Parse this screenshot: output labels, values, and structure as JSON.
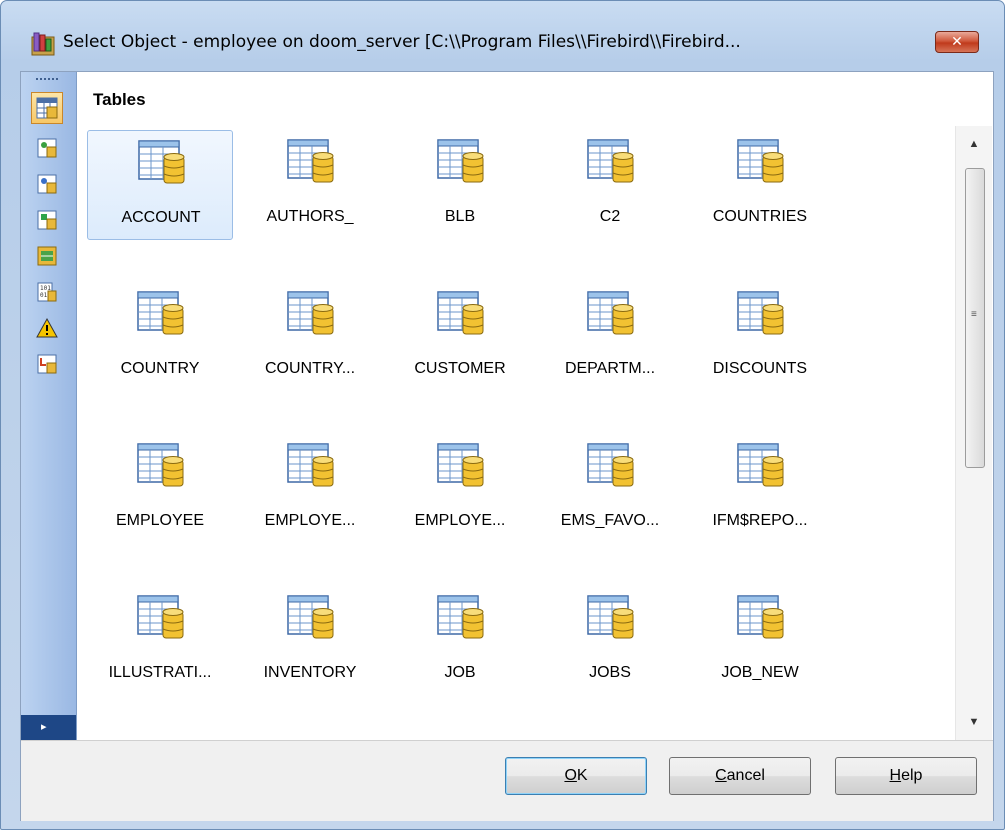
{
  "window": {
    "title": "Select Object - employee on doom_server [C:\\\\Program Files\\\\Firebird\\\\Firebird...",
    "close_glyph": "✕"
  },
  "section": {
    "title": "Tables"
  },
  "sidebar": {
    "items": [
      {
        "icon": "tables-icon",
        "active": true
      },
      {
        "icon": "views-icon",
        "active": false
      },
      {
        "icon": "procedures-icon",
        "active": false
      },
      {
        "icon": "functions-icon",
        "active": false
      },
      {
        "icon": "generators-icon",
        "active": false
      },
      {
        "icon": "domains-icon",
        "active": false
      },
      {
        "icon": "exceptions-icon",
        "active": false
      },
      {
        "icon": "triggers-icon",
        "active": false
      }
    ],
    "expand_glyph": "▸"
  },
  "objects": [
    "ACCOUNT",
    "AUTHORS_",
    "BLB",
    "C2",
    "COUNTRIES",
    "COUNTRY",
    "COUNTRY...",
    "CUSTOMER",
    "DEPARTM...",
    "DISCOUNTS",
    "EMPLOYEE",
    "EMPLOYE...",
    "EMPLOYE...",
    "EMS_FAVO...",
    "IFM$REPO...",
    "ILLUSTRATI...",
    "INVENTORY",
    "JOB",
    "JOBS",
    "JOB_NEW"
  ],
  "selected_object": "ACCOUNT",
  "buttons": {
    "ok": {
      "accel": "O",
      "rest": "K"
    },
    "cancel": {
      "accel": "C",
      "rest": "ancel"
    },
    "help": {
      "accel": "H",
      "rest": "elp"
    }
  },
  "colors": {
    "selection_border": "#9bbde6",
    "sidebar_active": "#f8c867",
    "sidebar_bottom": "#1e4786"
  }
}
